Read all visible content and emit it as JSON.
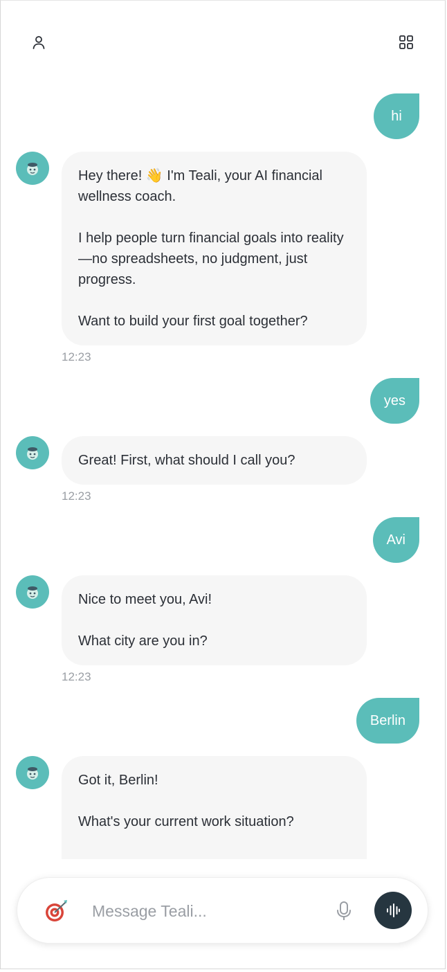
{
  "header": {
    "profile_icon": "user-icon",
    "menu_icon": "grid-icon"
  },
  "conversation": {
    "m1": {
      "text": "hi"
    },
    "b1": {
      "lines": [
        "Hey there! 👋 I'm Teali, your AI financial wellness coach.",
        "I help people turn financial goals into reality—no spreadsheets, no judgment, just progress.",
        "Want to build your first goal together?"
      ],
      "time": "12:23"
    },
    "m2": {
      "text": "yes"
    },
    "b2": {
      "lines": [
        "Great! First, what should I call you?"
      ],
      "time": "12:23"
    },
    "m3": {
      "text": "Avi"
    },
    "b3": {
      "lines": [
        "Nice to meet you, Avi!",
        "What city are you in?"
      ],
      "time": "12:23"
    },
    "m4": {
      "text": "Berlin"
    },
    "b4": {
      "lines": [
        "Got it, Berlin!",
        "What's your current work situation?"
      ]
    }
  },
  "composer": {
    "placeholder": "Message Teali...",
    "goal_icon": "target-icon",
    "mic_icon": "microphone-icon",
    "voice_icon": "waveform-icon"
  },
  "colors": {
    "accent": "#5bbdb9",
    "bot_bubble": "#f6f6f6",
    "voice_button": "#263640",
    "timestamp": "#9a9ea4"
  }
}
